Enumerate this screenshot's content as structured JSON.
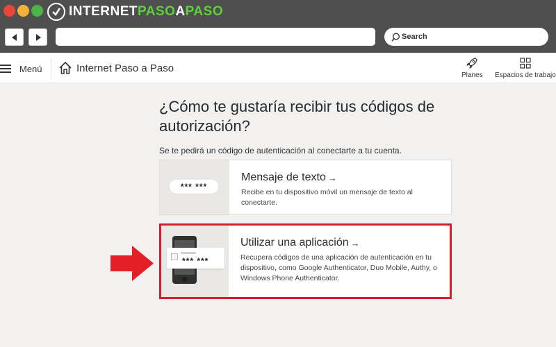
{
  "browser": {
    "brand_part1": "INTERNET",
    "brand_part2": "PASO",
    "brand_part3": "A",
    "brand_part4": "PASO",
    "search_label": "Search",
    "address_value": ""
  },
  "header": {
    "menu_label": "Menú",
    "site_title": "Internet Paso a Paso",
    "actions": [
      {
        "label": "Planes",
        "icon": "rocket-icon"
      },
      {
        "label": "Espacios de trabajo",
        "icon": "grid-icon"
      }
    ]
  },
  "main": {
    "title": "¿Cómo te gustaría recibir tus códigos de autorización?",
    "subtitle": "Se te pedirá un código de autenticación al conectarte a tu cuenta.",
    "options": [
      {
        "title": "Mensaje de texto",
        "arrow": "→",
        "description": "Recibe en tu dispositivo móvil un mensaje de texto al conectarte.",
        "code": "*** ***"
      },
      {
        "title": "Utilizar una aplicación",
        "arrow": "→",
        "description": "Recupera códigos de una aplicación de autenticación en tu dispositivo, como Google Authenticator, Duo Mobile, Authy, o Windows Phone Authenticator.",
        "code": "*** ***"
      }
    ]
  },
  "colors": {
    "highlight": "#d51d2b",
    "chrome": "#4f4f4f",
    "brand_accent": "#5fcf3c"
  }
}
